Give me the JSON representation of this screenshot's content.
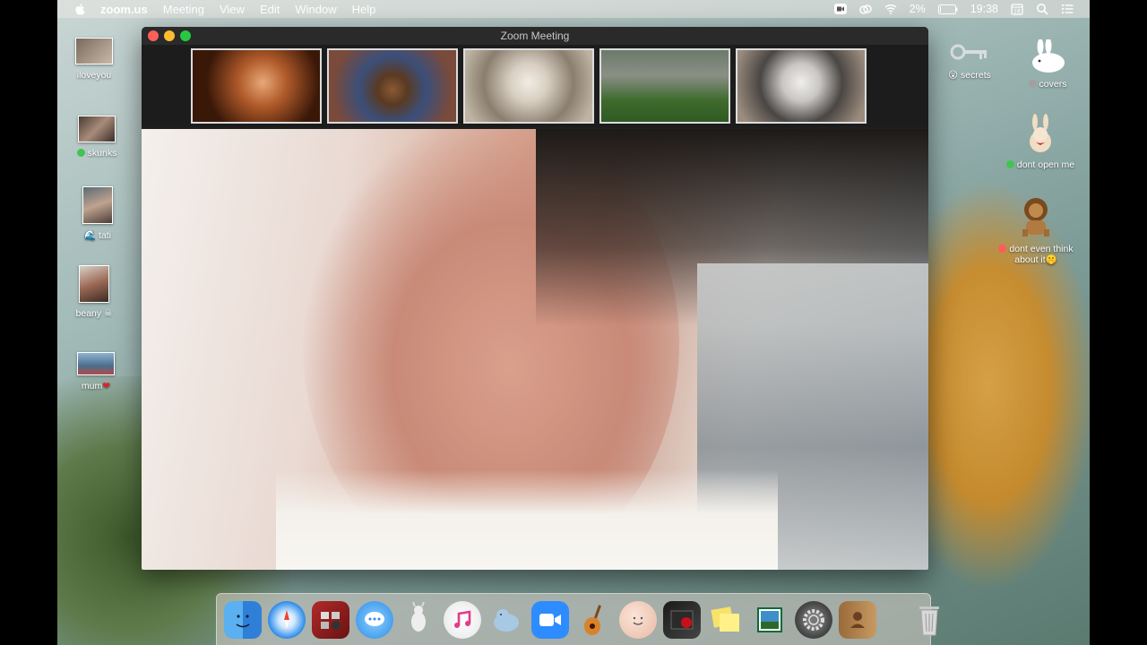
{
  "menubar": {
    "app_name": "zoom.us",
    "menus": [
      "Meeting",
      "View",
      "Edit",
      "Window",
      "Help"
    ],
    "battery": "2%",
    "time": "19:38"
  },
  "desktop_left": [
    {
      "label": "iloveyou",
      "tag": null
    },
    {
      "label": "skunks",
      "tag": "#41c451"
    },
    {
      "label": "tati",
      "prefix": "🌊"
    },
    {
      "label": "beany",
      "suffix": "☠"
    },
    {
      "label": "mum",
      "suffix": "❤"
    }
  ],
  "desktop_right": [
    {
      "label": "secrets",
      "prefix": "😮"
    },
    {
      "label": "covers",
      "tag": "#a0a0a0"
    },
    {
      "label": "dont open me",
      "tag": "#41c451"
    },
    {
      "label": "dont even think about it",
      "tag": "#ff5b5b",
      "suffix": "🤫"
    }
  ],
  "zoom": {
    "title": "Zoom Meeting",
    "participants": [
      "participant-1",
      "participant-2",
      "participant-3",
      "participant-4",
      "participant-5"
    ]
  },
  "dock_apps": [
    "finder",
    "safari",
    "photo-booth",
    "messages",
    "kangaroo",
    "music",
    "seal",
    "zoom",
    "garageband",
    "face",
    "photo-app",
    "stickies",
    "preview",
    "system-preferences",
    "contacts"
  ],
  "colors": {
    "traffic_red": "#fe5f57",
    "traffic_yellow": "#febc2e",
    "traffic_green": "#28c840",
    "accent": "#2d8cff"
  }
}
